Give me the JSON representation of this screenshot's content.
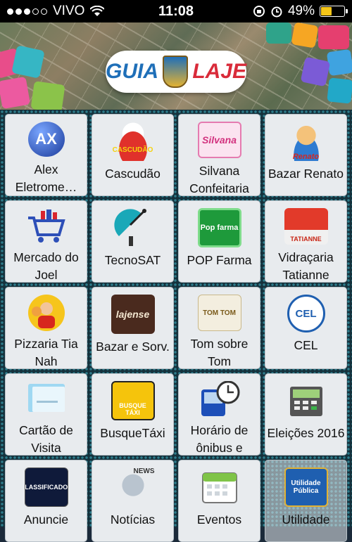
{
  "status": {
    "carrier": "VIVO",
    "time": "11:08",
    "battery": "49%"
  },
  "banner": {
    "logo_left": "GUIA",
    "logo_right": "LAJE"
  },
  "items": [
    {
      "label": "Alex Eletrome…",
      "icon": "ax-logo-icon"
    },
    {
      "label": "Cascudão",
      "icon": "chef-logo-icon"
    },
    {
      "label": "Silvana Confeitaria",
      "icon": "cake-logo-icon"
    },
    {
      "label": "Bazar Renato",
      "icon": "mascot-logo-icon"
    },
    {
      "label": "Mercado do Joel",
      "icon": "shopping-cart-icon"
    },
    {
      "label": "TecnoSAT",
      "icon": "satellite-dish-icon"
    },
    {
      "label": "POP Farma",
      "icon": "pharmacy-logo-icon"
    },
    {
      "label": "Vidraçaria Tatianne",
      "icon": "glass-shop-logo-icon"
    },
    {
      "label": "Pizzaria Tia Nah",
      "icon": "pizza-chef-icon"
    },
    {
      "label": "Bazar e Sorv.",
      "icon": "bazar-sign-icon"
    },
    {
      "label": "Tom sobre Tom",
      "icon": "tom-sobre-tom-logo-icon"
    },
    {
      "label": "CEL",
      "icon": "cel-school-logo-icon"
    },
    {
      "label": "Cartão de Visita",
      "icon": "business-card-icon"
    },
    {
      "label": "BusqueTáxi",
      "icon": "taxi-icon"
    },
    {
      "label": "Horário de ônibus e",
      "icon": "bus-clock-icon"
    },
    {
      "label": "Eleições 2016",
      "icon": "ballot-box-icon"
    },
    {
      "label": "Anuncie",
      "icon": "classificados-icon"
    },
    {
      "label": "Notícias",
      "icon": "newspaper-icon"
    },
    {
      "label": "Eventos",
      "icon": "calendar-icon"
    },
    {
      "label": "Utilidade",
      "icon": "utilidade-publica-icon"
    }
  ],
  "icon_texts": {
    "cascudao": "CASCUDÃO",
    "silvana": "Silvana",
    "renato": "Renato",
    "popfarma": "Pop farma",
    "tatianne": "TATIANNE",
    "lajense": "lajense",
    "tom": "TOM TOM",
    "cel": "CEL",
    "busque": "BUSQUE TÁXI",
    "classificados": "CLASSIFICADOS",
    "news": "NEWS",
    "utilidade": "Utilidade Pública"
  },
  "colors": {
    "accent_battery": "#f5c518",
    "grid_bg": "#15323d",
    "cell_bg": "#e8ebee"
  }
}
